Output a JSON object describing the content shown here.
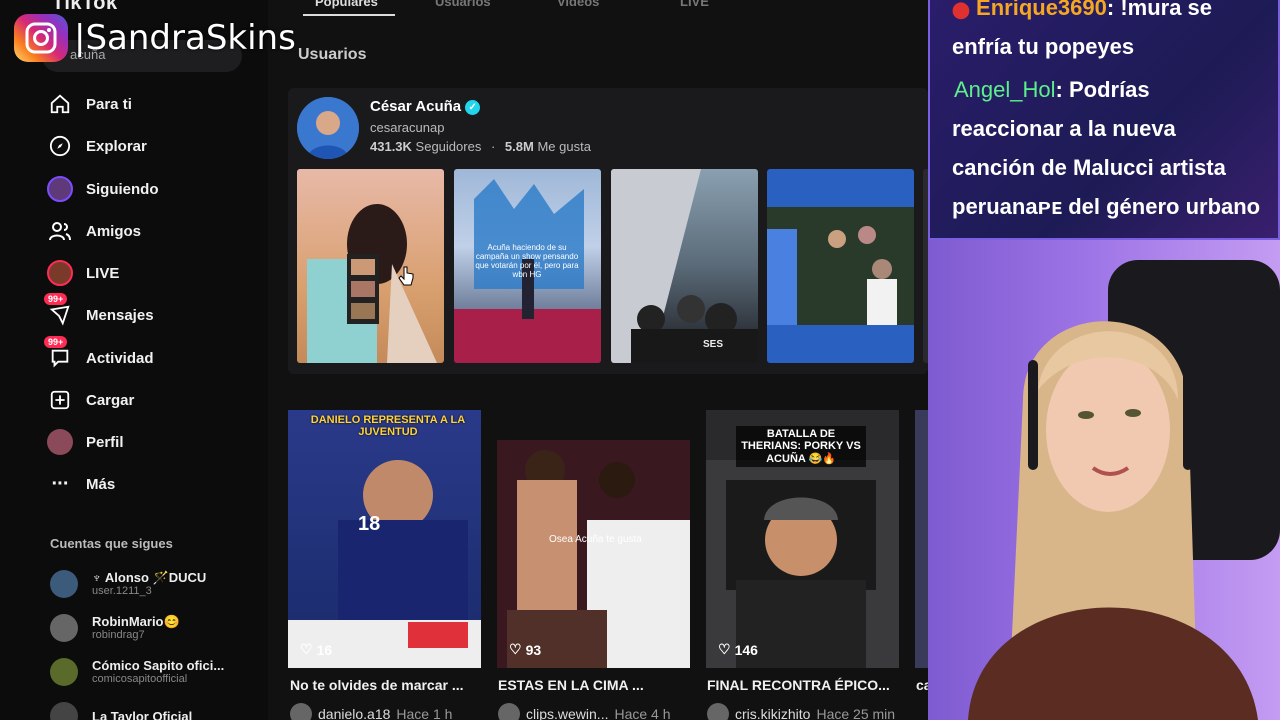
{
  "overlay": {
    "instagram_handle": "|SandraSkins"
  },
  "tiktok": {
    "logo": "TikTok",
    "search_value": "acuña",
    "tabs": [
      "Populares",
      "Usuarios",
      "Videos",
      "LIVE"
    ],
    "nav": [
      {
        "label": "Para ti",
        "icon": "home-icon"
      },
      {
        "label": "Explorar",
        "icon": "compass-icon"
      },
      {
        "label": "Siguiendo",
        "icon": "following-avatar-icon"
      },
      {
        "label": "Amigos",
        "icon": "friends-icon"
      },
      {
        "label": "LIVE",
        "icon": "live-avatar-icon"
      },
      {
        "label": "Mensajes",
        "icon": "messages-icon",
        "badge": "99+"
      },
      {
        "label": "Actividad",
        "icon": "activity-icon",
        "badge": "99+"
      },
      {
        "label": "Cargar",
        "icon": "upload-icon"
      },
      {
        "label": "Perfil",
        "icon": "profile-avatar-icon"
      },
      {
        "label": "Más",
        "icon": "more-icon"
      }
    ],
    "following_title": "Cuentas que sigues",
    "following": [
      {
        "name": "♆ Alonso 🪄DUCU",
        "handle": "user.1211_3"
      },
      {
        "name": "RobinMario😊",
        "handle": "robindrag7"
      },
      {
        "name": "Cómico Sapito ofici...",
        "handle": "comicosapitoofficial"
      },
      {
        "name": "La Taylor Oficial",
        "handle": ""
      }
    ],
    "users_section": "Usuarios",
    "user": {
      "name": "César Acuña",
      "handle": "cesaracunap",
      "followers": "431.3K",
      "followers_label": "Seguidores",
      "likes": "5.8M",
      "likes_label": "Me gusta"
    },
    "thumb_captions": [
      "Acuña haciendo de su campaña un show pensando que votarán por él, pero para wbn HG"
    ],
    "videos": [
      {
        "overlay": "DANIELO REPRESENTA A LA JUVENTUD",
        "likes": "16",
        "title": "No te olvides de marcar ...",
        "author": "danielo.a18",
        "time": "Hace 1 h"
      },
      {
        "overlay": "Osea Acuña te gusta",
        "likes": "93",
        "title": "ESTAS EN LA CIMA ...",
        "author": "clips.wewin...",
        "time": "Hace 4 h"
      },
      {
        "overlay": "BATALLA DE THERIANS: PORKY VS ACUÑA 😂🔥",
        "likes": "146",
        "title": "FINAL RECONTRA ÉPICO...",
        "author": "cris.kikizhito",
        "time": "Hace 25 min"
      },
      {
        "overlay": "",
        "likes": "",
        "title": "ca",
        "author": "",
        "time": ""
      }
    ]
  },
  "chat": [
    {
      "user": "Enrique3690",
      "user_color": "#f5a623",
      "text": ": !mura se"
    },
    {
      "user": "",
      "text": "enfría tu popeyes"
    },
    {
      "user": "Angel_Hol",
      "user_color": "#5cf08a",
      "text": ": Podrías"
    },
    {
      "user": "",
      "text": "reaccionar a la nueva"
    },
    {
      "user": "",
      "text": "canción de Malucci artista"
    },
    {
      "user": "",
      "text": "peruanaᴘᴇ del género urbano"
    }
  ],
  "colors": {
    "accent": "#fe2c55",
    "verified": "#20d5ec",
    "chat_border": "#7a5fe0"
  }
}
